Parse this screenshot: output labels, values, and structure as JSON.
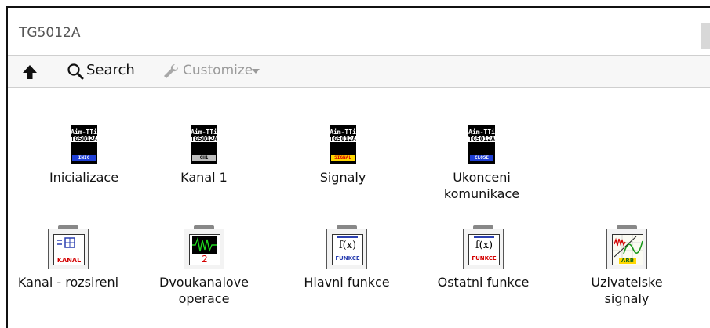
{
  "window": {
    "title": "TG5012A"
  },
  "toolbar": {
    "up_icon": "arrow-up-icon",
    "search_icon": "magnifier-icon",
    "search_label": "Search",
    "customize_icon": "wrench-icon",
    "customize_label": "Customize"
  },
  "palette": {
    "row1": [
      {
        "label": "Inicializace",
        "icon_top": "Aim-TTi",
        "icon_model": "TG5012A",
        "icon_band": "INIC",
        "band_color": "#1f3fd6",
        "band_text_color": "#ffffff"
      },
      {
        "label": "Kanal 1",
        "icon_top": "Aim-TTi",
        "icon_model": "TG5012A",
        "icon_band": "CH1",
        "band_color": "#bdbdbd",
        "band_text_color": "#000000"
      },
      {
        "label": "Signaly",
        "icon_top": "Aim-TTi",
        "icon_model": "TG5012A",
        "icon_band": "SIGNAL",
        "band_color": "#ffd800",
        "band_text_color": "#d40000"
      },
      {
        "label_line1": "Ukonceni",
        "label_line2": "komunikace",
        "icon_top": "Aim-TTi",
        "icon_model": "TG5012A",
        "icon_band": "CLOSE",
        "band_color": "#1f3fd6",
        "band_text_color": "#ffffff"
      }
    ],
    "row2": [
      {
        "label": "Kanal - rozsireni",
        "icon_name": "channel-extension-icon",
        "icon_text": "KANAL"
      },
      {
        "label_line1": "Dvoukanalove",
        "label_line2": "operace",
        "icon_name": "dual-channel-scope-icon",
        "icon_text": "2"
      },
      {
        "label": "Hlavni funkce",
        "icon_name": "function-fx-icon",
        "icon_glyph": "f(x)",
        "icon_text": "FUNKCE"
      },
      {
        "label": "Ostatni funkce",
        "icon_name": "function-fx-icon",
        "icon_glyph": "f(x)",
        "icon_text": "FUNKCE"
      },
      {
        "label_line1": "Uzivatelske",
        "label_line2": "signaly",
        "icon_name": "arbitrary-waveform-icon",
        "icon_text": "ARB"
      }
    ]
  }
}
